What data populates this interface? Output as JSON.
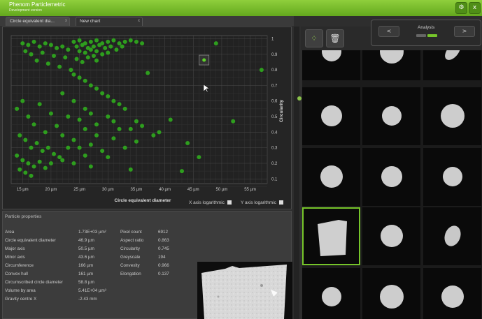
{
  "window": {
    "title": "Phenom Particlemetric",
    "subtitle": "Development version",
    "settings_icon": "gear-icon",
    "close_label": "x"
  },
  "tabs": [
    {
      "label": "Circle equivalent dia...",
      "close": "x",
      "active": true
    },
    {
      "label": "New chart",
      "close": "x",
      "active": false
    }
  ],
  "chart": {
    "xlabel": "Circle equivalent diameter",
    "ylabel": "Circularity",
    "x_ticks": [
      "15 µm",
      "20 µm",
      "25 µm",
      "30 µm",
      "35 µm",
      "40 µm",
      "45 µm",
      "50 µm",
      "55 µm"
    ],
    "y_ticks": [
      "1",
      "0.9",
      "0.8",
      "0.7",
      "0.6",
      "0.5",
      "0.4",
      "0.3",
      "0.2",
      "0.1"
    ],
    "x_log_label": "X axis logarithmic",
    "y_log_label": "Y axis logarithmic",
    "x_log_checked": false,
    "y_log_checked": false,
    "point_color": "#2e9e1e"
  },
  "chart_data": {
    "type": "scatter",
    "xlabel": "Circle equivalent diameter",
    "ylabel": "Circularity",
    "xlim": [
      13,
      58
    ],
    "ylim": [
      0.07,
      1.02
    ],
    "grid": true,
    "selected_point": [
      46.9,
      0.863
    ],
    "series": [
      {
        "points": [
          [
            24,
            0.98
          ],
          [
            25,
            0.99
          ],
          [
            26,
            0.97
          ],
          [
            27,
            0.98
          ],
          [
            28,
            0.99
          ],
          [
            29,
            0.97
          ],
          [
            30,
            0.98
          ],
          [
            31,
            0.99
          ],
          [
            32,
            0.97
          ],
          [
            33,
            0.98
          ],
          [
            34,
            0.99
          ],
          [
            35,
            0.98
          ],
          [
            36,
            0.97
          ],
          [
            24.5,
            0.95
          ],
          [
            25.5,
            0.96
          ],
          [
            26.5,
            0.94
          ],
          [
            27.5,
            0.95
          ],
          [
            28.5,
            0.96
          ],
          [
            29.5,
            0.94
          ],
          [
            30.5,
            0.95
          ],
          [
            31.5,
            0.93
          ],
          [
            32.5,
            0.95
          ],
          [
            25,
            0.92
          ],
          [
            26,
            0.91
          ],
          [
            27,
            0.93
          ],
          [
            28,
            0.92
          ],
          [
            29,
            0.9
          ],
          [
            30,
            0.91
          ],
          [
            26.5,
            0.88
          ],
          [
            27.5,
            0.89
          ],
          [
            28,
            0.86
          ],
          [
            25.5,
            0.85
          ],
          [
            24.5,
            0.87
          ],
          [
            15,
            0.97
          ],
          [
            16,
            0.96
          ],
          [
            17,
            0.98
          ],
          [
            18,
            0.95
          ],
          [
            19,
            0.97
          ],
          [
            20,
            0.96
          ],
          [
            21,
            0.94
          ],
          [
            22,
            0.95
          ],
          [
            23,
            0.93
          ],
          [
            15.5,
            0.92
          ],
          [
            16.5,
            0.9
          ],
          [
            18.5,
            0.91
          ],
          [
            20.5,
            0.89
          ],
          [
            22.5,
            0.88
          ],
          [
            17.5,
            0.86
          ],
          [
            19.5,
            0.84
          ],
          [
            21.5,
            0.82
          ],
          [
            23.5,
            0.8
          ],
          [
            24,
            0.77
          ],
          [
            25,
            0.75
          ],
          [
            26,
            0.73
          ],
          [
            27,
            0.7
          ],
          [
            28,
            0.68
          ],
          [
            29,
            0.65
          ],
          [
            30,
            0.63
          ],
          [
            31,
            0.6
          ],
          [
            32,
            0.58
          ],
          [
            26,
            0.55
          ],
          [
            27,
            0.52
          ],
          [
            24,
            0.6
          ],
          [
            22,
            0.65
          ],
          [
            23,
            0.5
          ],
          [
            25,
            0.48
          ],
          [
            28,
            0.45
          ],
          [
            30,
            0.5
          ],
          [
            33,
            0.55
          ],
          [
            35,
            0.47
          ],
          [
            14,
            0.55
          ],
          [
            15,
            0.6
          ],
          [
            16,
            0.5
          ],
          [
            17,
            0.45
          ],
          [
            18,
            0.58
          ],
          [
            19,
            0.4
          ],
          [
            20,
            0.52
          ],
          [
            21,
            0.44
          ],
          [
            22,
            0.38
          ],
          [
            14.5,
            0.38
          ],
          [
            15.5,
            0.35
          ],
          [
            16.5,
            0.3
          ],
          [
            17.5,
            0.33
          ],
          [
            18.5,
            0.28
          ],
          [
            19.5,
            0.3
          ],
          [
            20.5,
            0.26
          ],
          [
            21.5,
            0.24
          ],
          [
            14,
            0.25
          ],
          [
            15,
            0.22
          ],
          [
            16,
            0.2
          ],
          [
            17,
            0.18
          ],
          [
            18,
            0.21
          ],
          [
            19,
            0.17
          ],
          [
            20,
            0.2
          ],
          [
            14.5,
            0.16
          ],
          [
            15.5,
            0.14
          ],
          [
            16.5,
            0.12
          ],
          [
            24,
            0.35
          ],
          [
            25,
            0.3
          ],
          [
            26,
            0.25
          ],
          [
            27,
            0.32
          ],
          [
            29,
            0.28
          ],
          [
            31,
            0.36
          ],
          [
            33,
            0.3
          ],
          [
            34,
            0.42
          ],
          [
            36,
            0.44
          ],
          [
            38,
            0.38
          ],
          [
            31,
            0.47
          ],
          [
            32,
            0.42
          ],
          [
            28,
            0.38
          ],
          [
            26,
            0.42
          ],
          [
            23,
            0.3
          ],
          [
            22,
            0.22
          ],
          [
            24,
            0.2
          ],
          [
            27,
            0.18
          ],
          [
            30,
            0.24
          ],
          [
            35,
            0.34
          ],
          [
            41,
            0.48
          ],
          [
            37,
            0.78
          ],
          [
            39,
            0.4
          ],
          [
            44,
            0.33
          ],
          [
            46,
            0.24
          ],
          [
            52,
            0.47
          ],
          [
            43,
            0.15
          ],
          [
            34,
            0.16
          ],
          [
            49,
            0.97
          ],
          [
            57,
            0.8
          ],
          [
            46.9,
            0.863
          ]
        ]
      }
    ]
  },
  "properties": {
    "title": "Particle properties",
    "left": [
      {
        "label": "Area",
        "value": "1.73E+03 µm²"
      },
      {
        "label": "Circle equivalent diameter",
        "value": "46.9 µm"
      },
      {
        "label": "Major axis",
        "value": "50.5 µm"
      },
      {
        "label": "Minor axis",
        "value": "43.6 µm"
      },
      {
        "label": "Circumference",
        "value": "166 µm"
      },
      {
        "label": "Convex hull",
        "value": "161 µm"
      },
      {
        "label": "Circumscribed circle diameter",
        "value": "58.8 µm"
      },
      {
        "label": "Volume by area",
        "value": "5.41E+04 µm³"
      },
      {
        "label": "Gravity centre X",
        "value": "-2.43 mm"
      }
    ],
    "right": [
      {
        "label": "Pixel count",
        "value": "6912"
      },
      {
        "label": "Aspect ratio",
        "value": "0.863"
      },
      {
        "label": "Circularity",
        "value": "0.745"
      },
      {
        "label": "Greyscale",
        "value": "194"
      },
      {
        "label": "Convexity",
        "value": "0.966"
      },
      {
        "label": "Elongation",
        "value": "0.137"
      }
    ]
  },
  "toolbar": {
    "analysis_label": "Analysis",
    "prev_label": "<",
    "next_label": ">",
    "scatter_icon": "scatter-plot-icon",
    "delete_icon": "trash-icon",
    "accent": "#76c52a"
  },
  "gallery": {
    "selected_index": 9,
    "count": 15
  }
}
